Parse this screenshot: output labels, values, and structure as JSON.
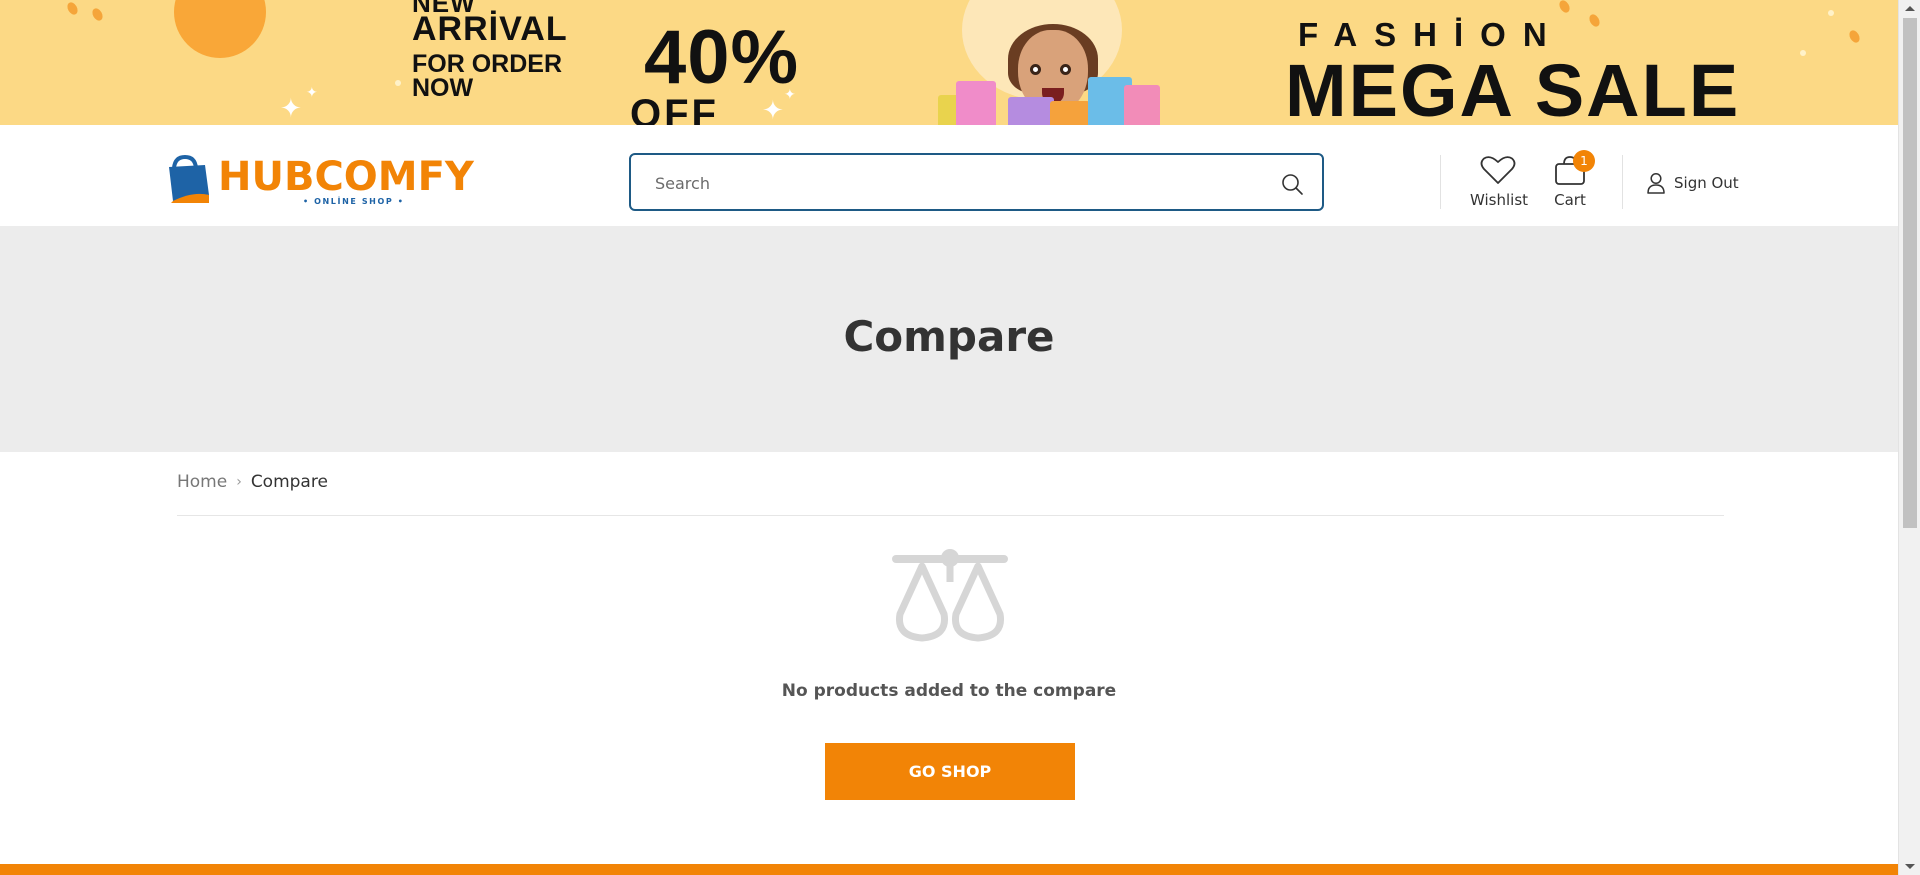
{
  "banner": {
    "new": "NEW",
    "arrival": "ARRİVAL",
    "order": "FOR ORDER\nNOW",
    "percent": "40%",
    "off": "OFF",
    "fashion": "FASHİON",
    "mega_sale": "MEGA SALE"
  },
  "header": {
    "logo_text": "HUBCOMFY",
    "logo_sub": "• ONLİNE SHOP •",
    "search_placeholder": "Search",
    "wishlist_label": "Wishlist",
    "cart_label": "Cart",
    "cart_count": "1",
    "signout_label": "Sign Out"
  },
  "page": {
    "title": "Compare",
    "breadcrumb_home": "Home",
    "breadcrumb_sep": "›",
    "breadcrumb_current": "Compare",
    "empty_message": "No products added to the compare",
    "go_shop_label": "GO SHOP"
  },
  "colors": {
    "accent": "#f28406",
    "banner_bg": "#fcd985",
    "hero_bg": "#ececec",
    "search_border": "#1e5a85"
  },
  "icons": {
    "search": "search-icon",
    "wishlist": "heart-icon",
    "cart": "shopping-bag-icon",
    "user": "user-icon",
    "compare": "balance-scale-icon"
  }
}
